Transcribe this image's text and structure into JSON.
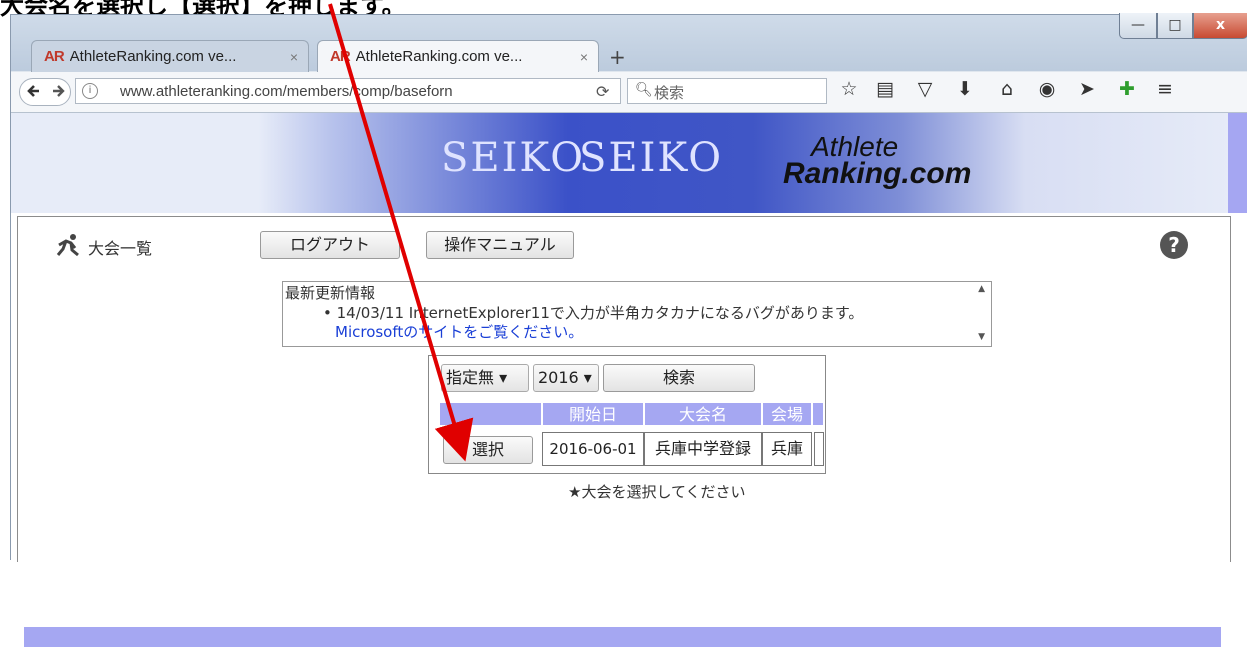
{
  "instruction": "大会名を選択し【選択】を押します。",
  "browser": {
    "tabs": [
      {
        "title": "AthleteRanking.com ve...",
        "close": "×"
      },
      {
        "title": "AthleteRanking.com ve...",
        "close": "×"
      }
    ],
    "new_tab": "+",
    "tab_logo": "AR",
    "window_controls": {
      "minimize": "—",
      "maximize": "□",
      "close": "x"
    },
    "url": "www.athleteranking.com/members/comp/baseforn",
    "search_placeholder": "検索",
    "toolbar_icons": [
      "star-icon",
      "reader-icon",
      "pocket-icon",
      "download-icon",
      "home-icon",
      "chat-icon",
      "send-icon",
      "puzzle-icon",
      "menu-icon"
    ]
  },
  "banner": {
    "sponsor_1": "SEIKO",
    "sponsor_2": "SEIKO",
    "logo_line1": "Athlete",
    "logo_line2": "Ranking.com"
  },
  "page": {
    "section_title": "大会一覧",
    "logout_button": "ログアウト",
    "manual_button": "操作マニュアル",
    "news": {
      "title": "最新更新情報",
      "item": "14/03/11 InternetExplorer11で入力が半角カタカナになるバグがあります。",
      "link": "Microsoftのサイトをご覧ください。"
    },
    "filter": {
      "category": "指定無",
      "year": "2016",
      "search_button": "検索"
    },
    "table": {
      "headers": [
        "",
        "開始日",
        "大会名",
        "会場",
        ""
      ],
      "rows": [
        {
          "action": "選択",
          "start_date": "2016-06-01",
          "name": "兵庫中学登録",
          "venue": "兵庫",
          "extra": ""
        }
      ]
    },
    "hint": "★大会を選択してください"
  },
  "colors": {
    "accent_purple": "#a5a7f2",
    "annotation_arrow": "#e00000",
    "link": "#1a3fd6"
  }
}
